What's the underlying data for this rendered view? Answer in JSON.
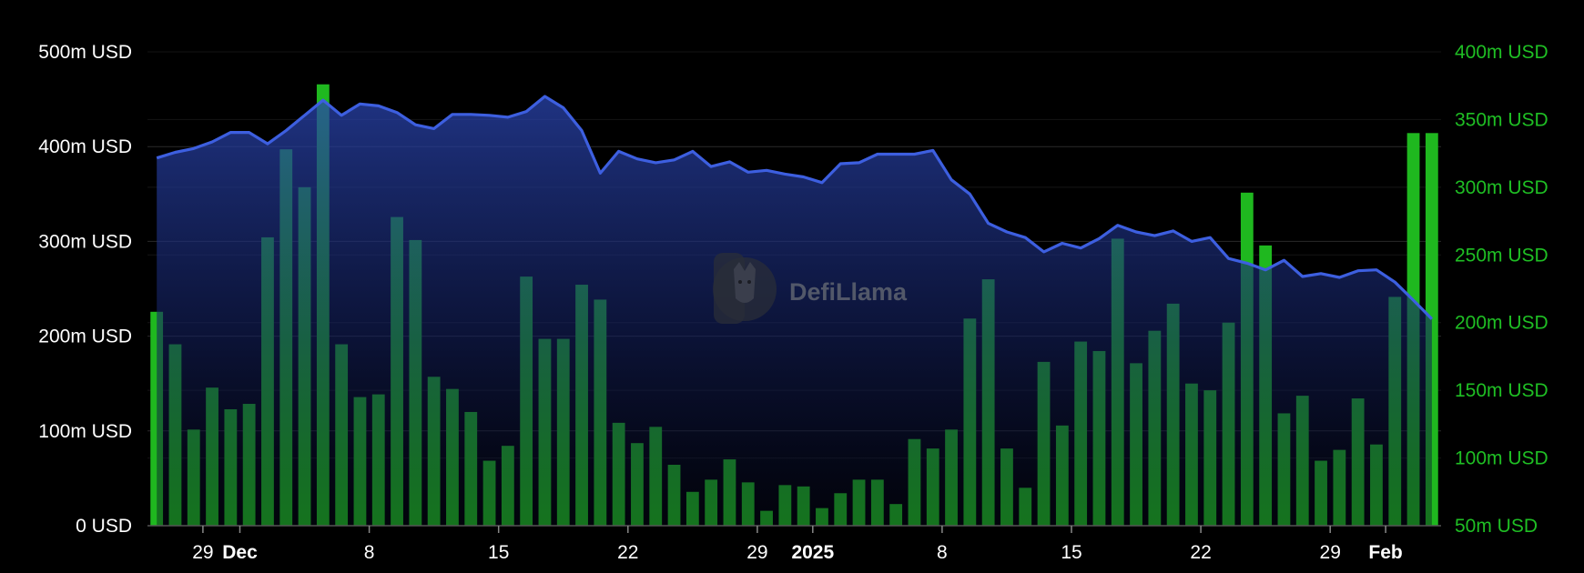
{
  "watermark": {
    "text": "DefiLlama",
    "icon": "llama-logo-icon"
  },
  "colors": {
    "line": "#3d5fe0",
    "bars": "#1fb81f",
    "right_axis": "#1fbf24",
    "left_axis": "#ffffff",
    "grid": "#2a2a2a",
    "background": "#000000"
  },
  "chart_data": {
    "type": "bar+area",
    "title": "",
    "grid": true,
    "x_tick_labels": [
      {
        "label": "29",
        "index": 3,
        "bold": false
      },
      {
        "label": "Dec",
        "index": 5,
        "bold": true
      },
      {
        "label": "8",
        "index": 12,
        "bold": false
      },
      {
        "label": "15",
        "index": 19,
        "bold": false
      },
      {
        "label": "22",
        "index": 26,
        "bold": false
      },
      {
        "label": "29",
        "index": 33,
        "bold": false
      },
      {
        "label": "2025",
        "index": 36,
        "bold": true
      },
      {
        "label": "8",
        "index": 43,
        "bold": false
      },
      {
        "label": "15",
        "index": 50,
        "bold": false
      },
      {
        "label": "22",
        "index": 57,
        "bold": false
      },
      {
        "label": "29",
        "index": 64,
        "bold": false
      },
      {
        "label": "Feb",
        "index": 67,
        "bold": true
      }
    ],
    "left_axis": {
      "ticks": [
        "0 USD",
        "100m USD",
        "200m USD",
        "300m USD",
        "400m USD",
        "500m USD"
      ],
      "ylim": [
        0,
        500
      ]
    },
    "right_axis": {
      "ticks": [
        "50m USD",
        "100m USD",
        "150m USD",
        "200m USD",
        "250m USD",
        "300m USD",
        "350m USD",
        "400m USD"
      ],
      "ylim": [
        50,
        400
      ]
    },
    "series": [
      {
        "type": "area",
        "axis": "left",
        "values": [
          388,
          394,
          398,
          405,
          415,
          415,
          403,
          417,
          433,
          449,
          433,
          445,
          443,
          436,
          423,
          419,
          434,
          434,
          433,
          431,
          437,
          453,
          441,
          417,
          372,
          395,
          387,
          383,
          386,
          395,
          379,
          384,
          373,
          375,
          371,
          368,
          362,
          382,
          383,
          392,
          392,
          392,
          396,
          365,
          350,
          319,
          310,
          304,
          289,
          298,
          293,
          303,
          317,
          310,
          306,
          311,
          300,
          304,
          282,
          277,
          270,
          280,
          263,
          266,
          262,
          269,
          270,
          257,
          238,
          218
        ]
      },
      {
        "type": "bar",
        "axis": "right",
        "values": [
          208,
          184,
          121,
          152,
          136,
          140,
          263,
          328,
          300,
          376,
          184,
          145,
          147,
          278,
          261,
          160,
          151,
          134,
          98,
          109,
          234,
          188,
          188,
          228,
          217,
          126,
          111,
          123,
          95,
          75,
          84,
          99,
          82,
          61,
          80,
          79,
          63,
          74,
          84,
          84,
          66,
          114,
          107,
          121,
          203,
          232,
          107,
          78,
          171,
          124,
          186,
          179,
          262,
          170,
          194,
          214,
          155,
          150,
          200,
          296,
          257,
          133,
          146,
          98,
          106,
          144,
          110,
          219,
          340,
          340
        ]
      }
    ]
  }
}
